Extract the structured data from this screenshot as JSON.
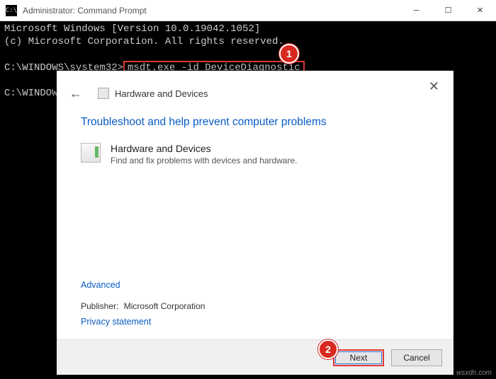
{
  "cmd": {
    "title": "Administrator: Command Prompt",
    "line1": "Microsoft Windows [Version 10.0.19042.1052]",
    "line2": "(c) Microsoft Corporation. All rights reserved.",
    "prompt1_pre": "C:\\WINDOWS\\system32>",
    "prompt1_cmd": "msdt.exe -id DeviceDiagnostic",
    "prompt2": "C:\\WINDOWS"
  },
  "callouts": {
    "one": "1",
    "two": "2"
  },
  "dialog": {
    "title": "Hardware and Devices",
    "heading": "Troubleshoot and help prevent computer problems",
    "hw_name": "Hardware and Devices",
    "hw_desc": "Find and fix problems with devices and hardware.",
    "advanced": "Advanced",
    "publisher_label": "Publisher:",
    "publisher_value": "Microsoft Corporation",
    "privacy": "Privacy statement",
    "next": "Next",
    "cancel": "Cancel",
    "close_glyph": "✕",
    "back_glyph": "←"
  },
  "watermark": "wsxdn.com"
}
